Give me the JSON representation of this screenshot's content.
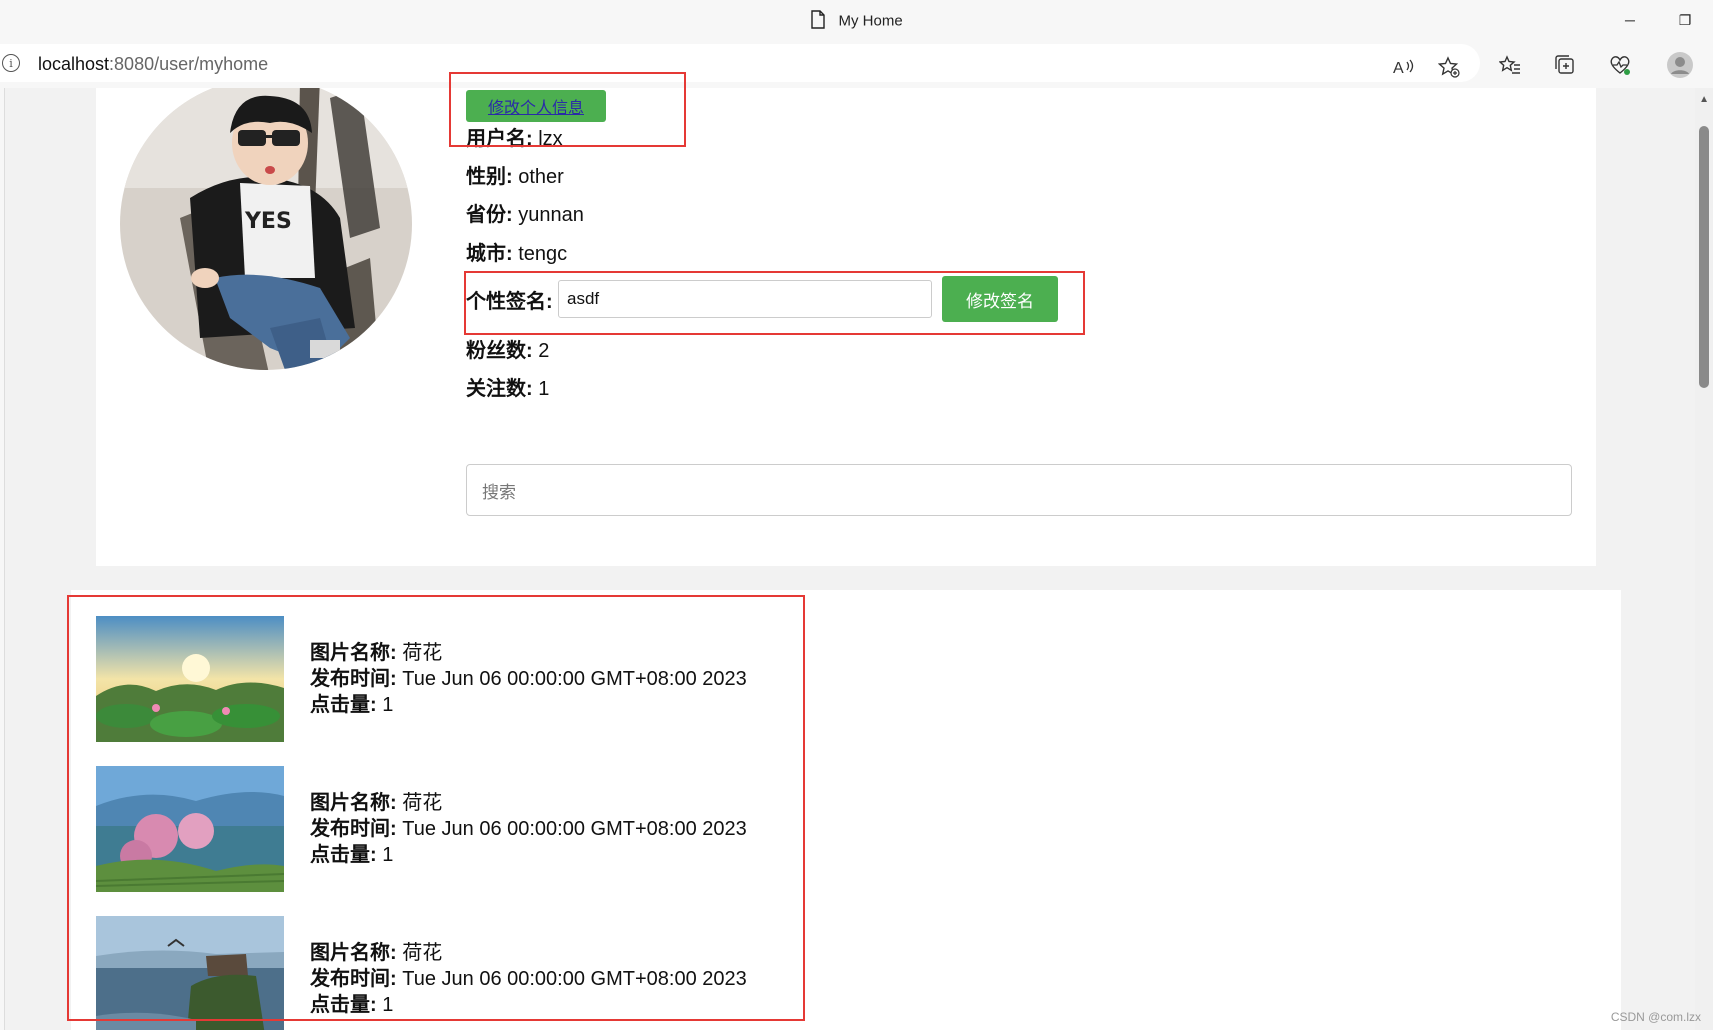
{
  "window": {
    "title": "My Home",
    "minimize_symbol": "─",
    "restore_symbol": "❐"
  },
  "address_bar": {
    "host": "localhost",
    "path": ":8080/user/myhome"
  },
  "profile": {
    "edit_button": "修改个人信息",
    "username_label": "用户名:",
    "username": "lzx",
    "gender_label": "性别:",
    "gender": "other",
    "province_label": "省份:",
    "province": "yunnan",
    "city_label": "城市:",
    "city": "tengc",
    "signature_label": "个性签名:",
    "signature": "asdf",
    "signature_button": "修改签名",
    "fans_label": "粉丝数:",
    "fans": "2",
    "following_label": "关注数:",
    "following": "1"
  },
  "search": {
    "placeholder": "搜索"
  },
  "posts": [
    {
      "name_label": "图片名称:",
      "name": "荷花",
      "time_label": "发布时间:",
      "time": "Tue Jun 06 00:00:00 GMT+08:00 2023",
      "clicks_label": "点击量:",
      "clicks": "1"
    },
    {
      "name_label": "图片名称:",
      "name": "荷花",
      "time_label": "发布时间:",
      "time": "Tue Jun 06 00:00:00 GMT+08:00 2023",
      "clicks_label": "点击量:",
      "clicks": "1"
    },
    {
      "name_label": "图片名称:",
      "name": "荷花",
      "time_label": "发布时间:",
      "time": "Tue Jun 06 00:00:00 GMT+08:00 2023",
      "clicks_label": "点击量:",
      "clicks": "1"
    }
  ],
  "watermark": "CSDN @com.lzx"
}
